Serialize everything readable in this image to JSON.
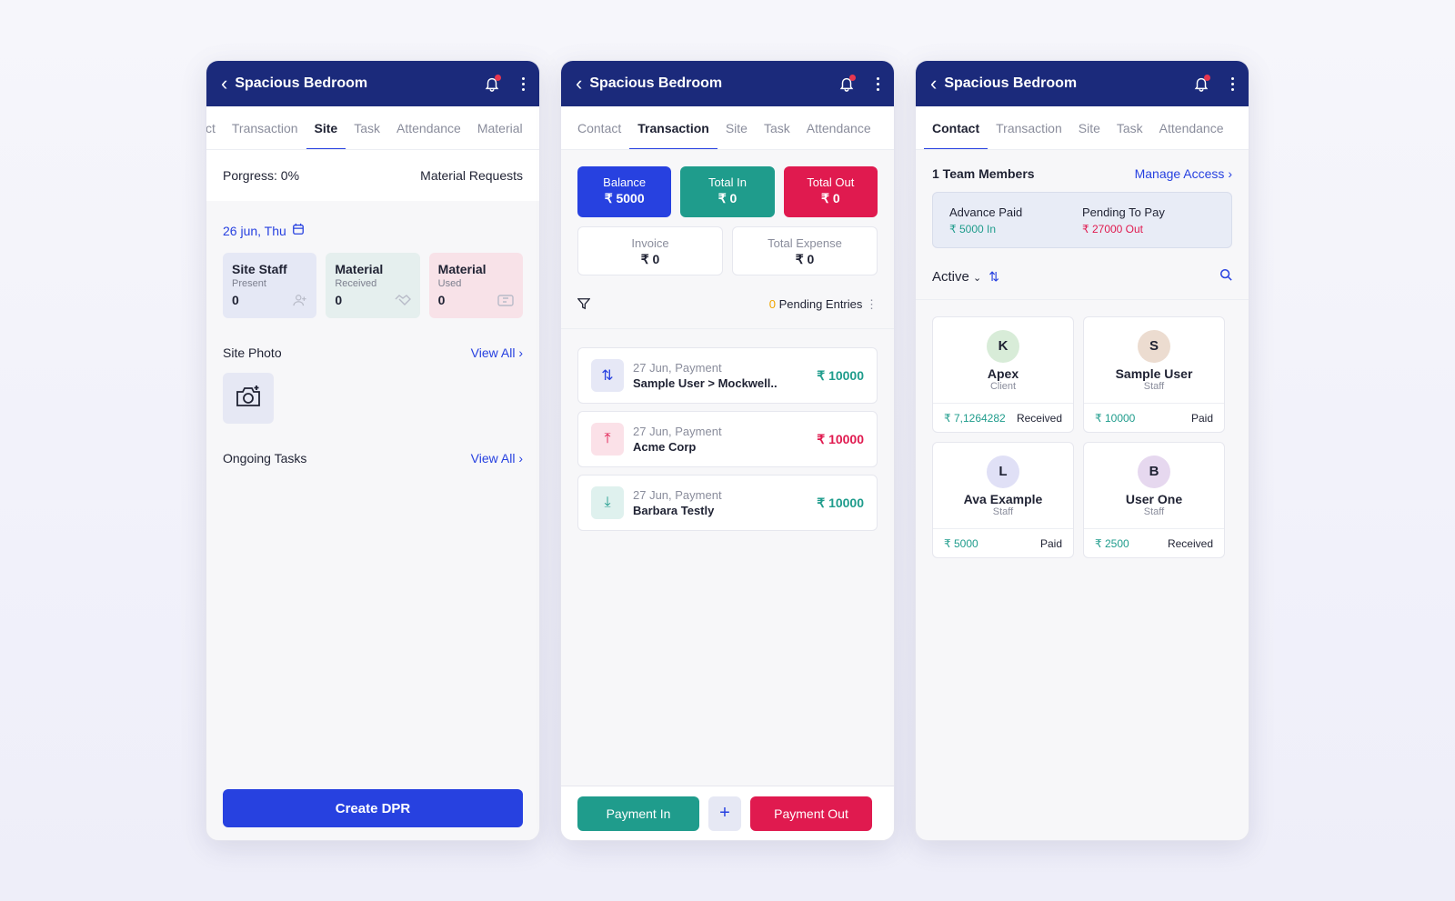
{
  "header_title": "Spacious Bedroom",
  "panel1": {
    "tabs": [
      "ct",
      "Transaction",
      "Site",
      "Task",
      "Attendance",
      "Material"
    ],
    "active_tab": "Site",
    "progress": "Porgress: 0%",
    "material_requests": "Material Requests",
    "date": "26 jun, Thu",
    "cards": [
      {
        "title": "Site Staff",
        "sub": "Present",
        "value": "0",
        "bg": "#e5e8f5"
      },
      {
        "title": "Material",
        "sub": "Received",
        "value": "0",
        "bg": "#e5efee"
      },
      {
        "title": "Material",
        "sub": "Used",
        "value": "0",
        "bg": "#f8e2e8"
      }
    ],
    "site_photo": "Site Photo",
    "view_all": "View All",
    "ongoing_tasks": "Ongoing Tasks",
    "create_dpr": "Create DPR"
  },
  "panel2": {
    "tabs": [
      "Contact",
      "Transaction",
      "Site",
      "Task",
      "Attendance"
    ],
    "active_tab": "Transaction",
    "summary": [
      {
        "label": "Balance",
        "value": "₹ 5000",
        "bg": "#2741e0"
      },
      {
        "label": "Total In",
        "value": "₹ 0",
        "bg": "#1f9c8c"
      },
      {
        "label": "Total Out",
        "value": "₹ 0",
        "bg": "#e01a4f"
      }
    ],
    "invoice_label": "Invoice",
    "invoice_value": "₹ 0",
    "expense_label": "Total Expense",
    "expense_value": "₹ 0",
    "pending_count": "0",
    "pending_label": "Pending Entries",
    "transactions": [
      {
        "meta": "27 Jun, Payment",
        "name": "Sample User >  Mockwell..",
        "amount": "₹ 10000",
        "type": "transfer"
      },
      {
        "meta": "27 Jun, Payment",
        "name": "Acme Corp",
        "amount": "₹ 10000",
        "type": "out"
      },
      {
        "meta": "27 Jun, Payment",
        "name": "Barbara Testly",
        "amount": "₹ 10000",
        "type": "in"
      }
    ],
    "payment_in": "Payment In",
    "plus": "+",
    "payment_out": "Payment Out"
  },
  "panel3": {
    "tabs": [
      "Contact",
      "Transaction",
      "Site",
      "Task",
      "Attendance"
    ],
    "active_tab": "Contact",
    "team_members": "1 Team Members",
    "manage_access": "Manage Access",
    "advance_label": "Advance Paid",
    "advance_value": "₹ 5000 In",
    "pending_label": "Pending To Pay",
    "pending_value": "₹ 27000 Out",
    "filter": "Active",
    "contacts": [
      {
        "initial": "K",
        "name": "Apex",
        "role": "Client",
        "amount": "₹ 7,1264282",
        "status": "Received",
        "avatar_bg": "#d8ecd8"
      },
      {
        "initial": "S",
        "name": "Sample User",
        "role": "Staff",
        "amount": "₹ 10000",
        "status": "Paid",
        "avatar_bg": "#ecdcd0"
      },
      {
        "initial": "L",
        "name": "Ava Example",
        "role": "Staff",
        "amount": "₹ 5000",
        "status": "Paid",
        "avatar_bg": "#e0e0f6"
      },
      {
        "initial": "B",
        "name": "User One",
        "role": "Staff",
        "amount": "₹ 2500",
        "status": "Received",
        "avatar_bg": "#e6d8ef"
      }
    ]
  }
}
